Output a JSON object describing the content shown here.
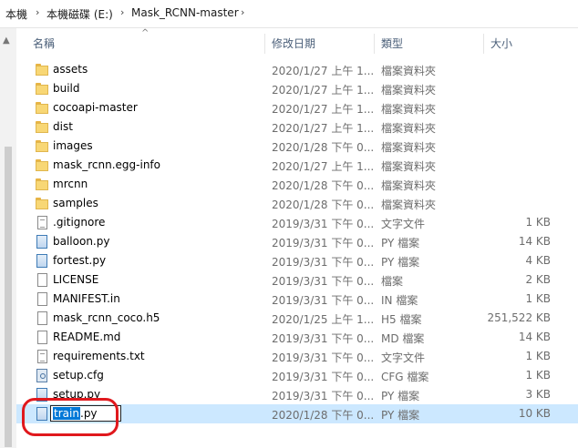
{
  "breadcrumb": {
    "items": [
      "本機",
      "本機磁碟 (E:)",
      "Mask_RCNN-master"
    ],
    "separator": "›"
  },
  "columns": {
    "name": "名稱",
    "date": "修改日期",
    "type": "類型",
    "size": "大小"
  },
  "files": [
    {
      "name": "assets",
      "date": "2020/1/27 上午 1...",
      "type": "檔案資料夾",
      "size": "",
      "icon": "folder-icon"
    },
    {
      "name": "build",
      "date": "2020/1/27 上午 1...",
      "type": "檔案資料夾",
      "size": "",
      "icon": "folder-icon"
    },
    {
      "name": "cocoapi-master",
      "date": "2020/1/27 上午 1...",
      "type": "檔案資料夾",
      "size": "",
      "icon": "folder-icon"
    },
    {
      "name": "dist",
      "date": "2020/1/27 上午 1...",
      "type": "檔案資料夾",
      "size": "",
      "icon": "folder-icon"
    },
    {
      "name": "images",
      "date": "2020/1/28 下午 0...",
      "type": "檔案資料夾",
      "size": "",
      "icon": "folder-icon"
    },
    {
      "name": "mask_rcnn.egg-info",
      "date": "2020/1/27 上午 1...",
      "type": "檔案資料夾",
      "size": "",
      "icon": "folder-icon"
    },
    {
      "name": "mrcnn",
      "date": "2020/1/28 下午 0...",
      "type": "檔案資料夾",
      "size": "",
      "icon": "folder-icon"
    },
    {
      "name": "samples",
      "date": "2020/1/28 下午 0...",
      "type": "檔案資料夾",
      "size": "",
      "icon": "folder-icon"
    },
    {
      "name": ".gitignore",
      "date": "2019/3/31 下午 0...",
      "type": "文字文件",
      "size": "1 KB",
      "icon": "text-file-icon"
    },
    {
      "name": "balloon.py",
      "date": "2019/3/31 下午 0...",
      "type": "PY 檔案",
      "size": "14 KB",
      "icon": "python-file-icon"
    },
    {
      "name": "fortest.py",
      "date": "2019/3/31 下午 0...",
      "type": "PY 檔案",
      "size": "4 KB",
      "icon": "python-file-icon"
    },
    {
      "name": "LICENSE",
      "date": "2019/3/31 下午 0...",
      "type": "檔案",
      "size": "2 KB",
      "icon": "file-icon"
    },
    {
      "name": "MANIFEST.in",
      "date": "2019/3/31 下午 0...",
      "type": "IN 檔案",
      "size": "1 KB",
      "icon": "file-icon"
    },
    {
      "name": "mask_rcnn_coco.h5",
      "date": "2020/1/25 上午 1...",
      "type": "H5 檔案",
      "size": "251,522 KB",
      "icon": "file-icon"
    },
    {
      "name": "README.md",
      "date": "2019/3/31 下午 0...",
      "type": "MD 檔案",
      "size": "14 KB",
      "icon": "file-icon"
    },
    {
      "name": "requirements.txt",
      "date": "2019/3/31 下午 0...",
      "type": "文字文件",
      "size": "1 KB",
      "icon": "text-file-icon"
    },
    {
      "name": "setup.cfg",
      "date": "2019/3/31 下午 0...",
      "type": "CFG 檔案",
      "size": "1 KB",
      "icon": "config-file-icon"
    },
    {
      "name": "setup.py",
      "date": "2019/3/31 下午 0...",
      "type": "PY 檔案",
      "size": "3 KB",
      "icon": "python-file-icon"
    }
  ],
  "renaming": {
    "selected_text": "train",
    "rest_text": ".py",
    "date": "2020/1/28 下午 0...",
    "type": "PY 檔案",
    "size": "10 KB",
    "icon": "python-file-icon"
  },
  "colors": {
    "selection_row": "#cce8ff",
    "text_selection": "#0078d7",
    "annotation": "#e0181d"
  }
}
